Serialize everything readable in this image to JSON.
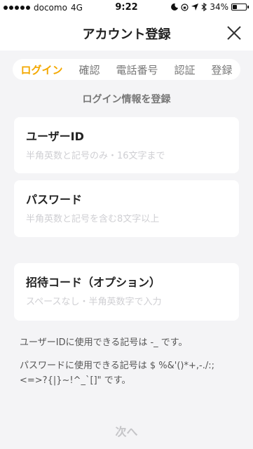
{
  "status_bar": {
    "carrier": "docomo",
    "network": "4G",
    "time": "9:22",
    "battery": "34%",
    "battery_level": 0.34
  },
  "nav": {
    "title": "アカウント登録",
    "close_icon": "close-icon"
  },
  "steps": [
    {
      "label": "ログイン",
      "active": true
    },
    {
      "label": "確認",
      "active": false
    },
    {
      "label": "電話番号",
      "active": false
    },
    {
      "label": "認証",
      "active": false
    },
    {
      "label": "登録",
      "active": false
    }
  ],
  "section_title": "ログイン情報を登録",
  "fields": {
    "user_id": {
      "label": "ユーザーID",
      "value": "",
      "placeholder": "半角英数と記号のみ・16文字まで"
    },
    "password": {
      "label": "パスワード",
      "value": "",
      "placeholder": "半角英数と記号を含む8文字以上"
    },
    "invite_code": {
      "label": "招待コード（オプション）",
      "value": "",
      "placeholder": "スペースなし・半角英数字で入力"
    }
  },
  "notes": {
    "user_id": "ユーザーIDに使用できる記号は -_ です。",
    "password": "パスワードに使用できる記号は $ %&'()*+,-./:;<=>?{|}~!^_`[]\" です。"
  },
  "next_label": "次へ",
  "colors": {
    "accent": "#f3a800",
    "background": "#f4f4f6",
    "card": "#ffffff",
    "muted": "#c5c5c8"
  }
}
